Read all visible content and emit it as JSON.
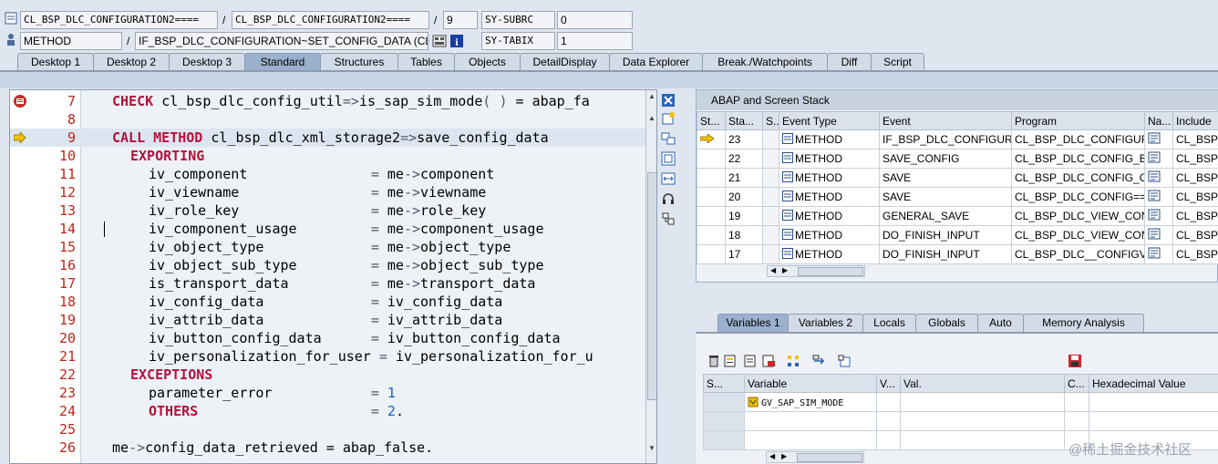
{
  "header": {
    "row1": {
      "program": "CL_BSP_DLC_CONFIGURATION2====",
      "include": "CL_BSP_DLC_CONFIGURATION2====",
      "line": "9",
      "sysvar_name": "SY-SUBRC",
      "sysvar_value": "0"
    },
    "row2": {
      "event_type": "METHOD",
      "event": "IF_BSP_DLC_CONFIGURATION~SET_CONFIG_DATA (CL_",
      "sysvar_name": "SY-TABIX",
      "sysvar_value": "1"
    },
    "slash": "/"
  },
  "tabs": [
    "Desktop 1",
    "Desktop 2",
    "Desktop 3",
    "Standard",
    "Structures",
    "Tables",
    "Objects",
    "DetailDisplay",
    "Data Explorer",
    "Break./Watchpoints",
    "Diff",
    "Script"
  ],
  "active_tab": "Standard",
  "code_lines": [
    {
      "n": "7",
      "parts": [
        [
          "kw",
          "CHECK "
        ],
        [
          "t",
          "cl_bsp_dlc_config_util"
        ],
        [
          "op",
          "=>"
        ],
        [
          "t",
          "is_sap_sim_mode"
        ],
        [
          "op",
          "( )"
        ],
        [
          "t",
          " = abap_fa"
        ]
      ],
      "indent": 0
    },
    {
      "n": "8",
      "parts": [],
      "indent": 0
    },
    {
      "n": "9",
      "parts": [
        [
          "kw",
          "CALL METHOD "
        ],
        [
          "t",
          "cl_bsp_dlc_xml_storage2"
        ],
        [
          "op",
          "=>"
        ],
        [
          "t",
          "save_config_data"
        ]
      ],
      "indent": 0
    },
    {
      "n": "10",
      "parts": [
        [
          "kw",
          "EXPORTING"
        ]
      ],
      "indent": 1
    },
    {
      "n": "11",
      "parts": [
        [
          "t",
          "iv_component               "
        ],
        [
          "op",
          "= "
        ],
        [
          "t",
          "me"
        ],
        [
          "op",
          "->"
        ],
        [
          "t",
          "component"
        ]
      ],
      "indent": 2
    },
    {
      "n": "12",
      "parts": [
        [
          "t",
          "iv_viewname                "
        ],
        [
          "op",
          "= "
        ],
        [
          "t",
          "me"
        ],
        [
          "op",
          "->"
        ],
        [
          "t",
          "viewname"
        ]
      ],
      "indent": 2
    },
    {
      "n": "13",
      "parts": [
        [
          "t",
          "iv_role_key                "
        ],
        [
          "op",
          "= "
        ],
        [
          "t",
          "me"
        ],
        [
          "op",
          "->"
        ],
        [
          "t",
          "role_key"
        ]
      ],
      "indent": 2
    },
    {
      "n": "14",
      "parts": [
        [
          "t",
          "iv_component_usage         "
        ],
        [
          "op",
          "= "
        ],
        [
          "t",
          "me"
        ],
        [
          "op",
          "->"
        ],
        [
          "t",
          "component_usage"
        ]
      ],
      "indent": 2
    },
    {
      "n": "15",
      "parts": [
        [
          "t",
          "iv_object_type             "
        ],
        [
          "op",
          "= "
        ],
        [
          "t",
          "me"
        ],
        [
          "op",
          "->"
        ],
        [
          "t",
          "object_type"
        ]
      ],
      "indent": 2
    },
    {
      "n": "16",
      "parts": [
        [
          "t",
          "iv_object_sub_type         "
        ],
        [
          "op",
          "= "
        ],
        [
          "t",
          "me"
        ],
        [
          "op",
          "->"
        ],
        [
          "t",
          "object_sub_type"
        ]
      ],
      "indent": 2
    },
    {
      "n": "17",
      "parts": [
        [
          "t",
          "is_transport_data          "
        ],
        [
          "op",
          "= "
        ],
        [
          "t",
          "me"
        ],
        [
          "op",
          "->"
        ],
        [
          "t",
          "transport_data"
        ]
      ],
      "indent": 2
    },
    {
      "n": "18",
      "parts": [
        [
          "t",
          "iv_config_data             "
        ],
        [
          "op",
          "= "
        ],
        [
          "t",
          "iv_config_data"
        ]
      ],
      "indent": 2
    },
    {
      "n": "19",
      "parts": [
        [
          "t",
          "iv_attrib_data             "
        ],
        [
          "op",
          "= "
        ],
        [
          "t",
          "iv_attrib_data"
        ]
      ],
      "indent": 2
    },
    {
      "n": "20",
      "parts": [
        [
          "t",
          "iv_button_config_data      "
        ],
        [
          "op",
          "= "
        ],
        [
          "t",
          "iv_button_config_data"
        ]
      ],
      "indent": 2
    },
    {
      "n": "21",
      "parts": [
        [
          "t",
          "iv_personalization_for_user "
        ],
        [
          "op",
          "= "
        ],
        [
          "t",
          "iv_personalization_for_u"
        ]
      ],
      "indent": 2
    },
    {
      "n": "22",
      "parts": [
        [
          "kw",
          "EXCEPTIONS"
        ]
      ],
      "indent": 1
    },
    {
      "n": "23",
      "parts": [
        [
          "t",
          "parameter_error            "
        ],
        [
          "op",
          "= "
        ],
        [
          "num",
          "1"
        ]
      ],
      "indent": 2
    },
    {
      "n": "24",
      "parts": [
        [
          "kw",
          "OTHERS"
        ],
        [
          "t",
          "                     "
        ],
        [
          "op",
          "= "
        ],
        [
          "num",
          "2"
        ],
        [
          "t",
          "."
        ]
      ],
      "indent": 2
    },
    {
      "n": "25",
      "parts": [],
      "indent": 0
    },
    {
      "n": "26",
      "parts": [
        [
          "t",
          "me"
        ],
        [
          "op",
          "->"
        ],
        [
          "t",
          "config_data_retrieved = abap_false."
        ]
      ],
      "indent": 0
    }
  ],
  "stack": {
    "title": "ABAP and Screen Stack",
    "columns": [
      "St...",
      "Sta...",
      "S...",
      "Event Type",
      "Event",
      "Program",
      "Na...",
      "Include"
    ],
    "rows": [
      {
        "level": "23",
        "type": "METHOD",
        "event": "IF_BSP_DLC_CONFIGURA",
        "program": "CL_BSP_DLC_CONFIGUR",
        "include": "CL_BSP_",
        "current": true
      },
      {
        "level": "22",
        "type": "METHOD",
        "event": "SAVE_CONFIG",
        "program": "CL_BSP_DLC_CONFIG_B",
        "include": "CL_BSP_",
        "current": false
      },
      {
        "level": "21",
        "type": "METHOD",
        "event": "SAVE",
        "program": "CL_BSP_DLC_CONFIG_O",
        "include": "CL_BSP_",
        "current": false
      },
      {
        "level": "20",
        "type": "METHOD",
        "event": "SAVE",
        "program": "CL_BSP_DLC_CONFIG==",
        "include": "CL_BSP_",
        "current": false
      },
      {
        "level": "19",
        "type": "METHOD",
        "event": "GENERAL_SAVE",
        "program": "CL_BSP_DLC_VIEW_CON",
        "include": "CL_BSP_",
        "current": false
      },
      {
        "level": "18",
        "type": "METHOD",
        "event": "DO_FINISH_INPUT",
        "program": "CL_BSP_DLC_VIEW_CON",
        "include": "CL_BSP_",
        "current": false
      },
      {
        "level": "17",
        "type": "METHOD",
        "event": "DO_FINISH_INPUT",
        "program": "CL_BSP_DLC__CONFIGV",
        "include": "CL_BSP_",
        "current": false
      }
    ]
  },
  "var_tabs": [
    "Variables 1",
    "Variables 2",
    "Locals",
    "Globals",
    "Auto",
    "Memory Analysis"
  ],
  "active_var_tab": "Variables 1",
  "variables": {
    "columns": [
      "S...",
      "Variable",
      "V...",
      "Val.",
      "C...",
      "Hexadecimal Value"
    ],
    "rows": [
      {
        "variable": "GV_SAP_SIM_MODE",
        "value": "",
        "hex": ""
      },
      {
        "variable": "",
        "value": "",
        "hex": ""
      },
      {
        "variable": "",
        "value": "",
        "hex": ""
      }
    ]
  },
  "watermark": "@稀土掘金技术社区",
  "colors": {
    "keyword": "#b5123b",
    "line_number": "#c0241a",
    "number": "#1c5fc6",
    "active_tab": "#9bb0cc"
  }
}
